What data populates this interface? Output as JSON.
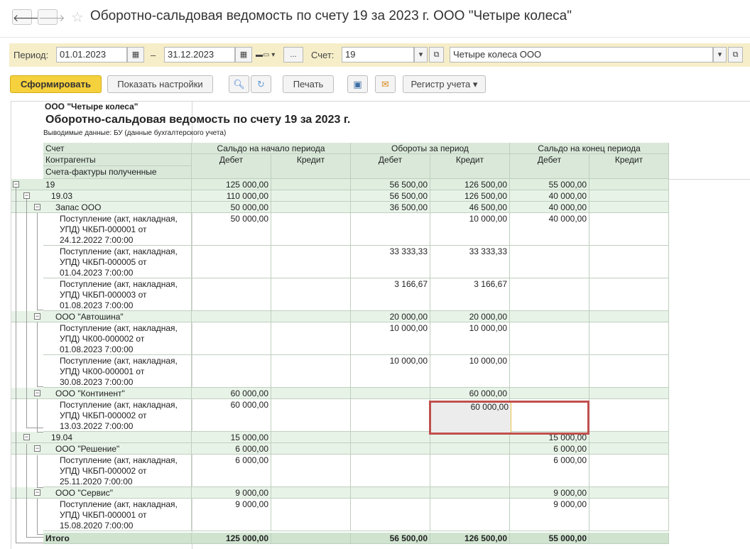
{
  "window": {
    "title": "Оборотно-сальдовая ведомость по счету 19 за 2023 г. ООО \"Четыре колеса\"",
    "back_glyph": "🡐",
    "fwd_glyph": "🡒",
    "star_glyph": "☆"
  },
  "params": {
    "period_label": "Период:",
    "date_from": "01.01.2023",
    "dash": "–",
    "date_to": "31.12.2023",
    "ellipsis": "...",
    "account_label": "Счет:",
    "account": "19",
    "org": "Четыре колеса ООО"
  },
  "toolbar": {
    "generate": "Сформировать",
    "show_settings": "Показать настройки",
    "print": "Печать",
    "register": "Регистр учета"
  },
  "report": {
    "org": "ООО \"Четыре колеса\"",
    "title": "Оборотно-сальдовая ведомость по счету 19 за 2023 г.",
    "subtitle": "Выводимые данные: БУ (данные бухгалтерского учета)",
    "headers": {
      "col1_line1": "Счет",
      "col1_line2": "Контрагенты",
      "col1_line3": "Счета-фактуры полученные",
      "opening": "Сальдо на начало периода",
      "turnover": "Обороты за период",
      "closing": "Сальдо на конец периода",
      "debit": "Дебет",
      "credit": "Кредит"
    },
    "rows": [
      {
        "text": "19",
        "lvl": 0,
        "kind": "g0",
        "v": [
          "125 000,00",
          "",
          "56 500,00",
          "126 500,00",
          "55 000,00",
          ""
        ]
      },
      {
        "text": "19.03",
        "lvl": 1,
        "kind": "g1",
        "v": [
          "110 000,00",
          "",
          "56 500,00",
          "126 500,00",
          "40 000,00",
          ""
        ]
      },
      {
        "text": "Запас ООО",
        "lvl": 2,
        "kind": "g1",
        "v": [
          "50 000,00",
          "",
          "36 500,00",
          "46 500,00",
          "40 000,00",
          ""
        ]
      },
      {
        "text": "Поступление (акт, накладная, УПД) ЧКБП-000001 от 24.12.2022 7:00:00",
        "lvl": 3,
        "kind": "doc",
        "v": [
          "50 000,00",
          "",
          "",
          "10 000,00",
          "40 000,00",
          ""
        ]
      },
      {
        "text": "Поступление (акт, накладная, УПД) ЧКБП-000005 от 01.04.2023 7:00:00",
        "lvl": 3,
        "kind": "doc",
        "v": [
          "",
          "",
          "33 333,33",
          "33 333,33",
          "",
          ""
        ]
      },
      {
        "text": "Поступление (акт, накладная, УПД) ЧКБП-000003 от 01.08.2023 7:00:00",
        "lvl": 3,
        "kind": "doc",
        "v": [
          "",
          "",
          "3 166,67",
          "3 166,67",
          "",
          ""
        ]
      },
      {
        "text": "ООО \"Автошина\"",
        "lvl": 2,
        "kind": "g1",
        "v": [
          "",
          "",
          "20 000,00",
          "20 000,00",
          "",
          ""
        ]
      },
      {
        "text": "Поступление (акт, накладная, УПД) ЧК00-000002 от 01.08.2023 7:00:00",
        "lvl": 3,
        "kind": "doc",
        "v": [
          "",
          "",
          "10 000,00",
          "10 000,00",
          "",
          ""
        ]
      },
      {
        "text": "Поступление (акт, накладная, УПД) ЧК00-000001 от 30.08.2023 7:00:00",
        "lvl": 3,
        "kind": "doc",
        "v": [
          "",
          "",
          "10 000,00",
          "10 000,00",
          "",
          ""
        ]
      },
      {
        "text": "ООО \"Континент\"",
        "lvl": 2,
        "kind": "g1",
        "v": [
          "60 000,00",
          "",
          "",
          "60 000,00",
          "",
          ""
        ]
      },
      {
        "text": "Поступление (акт, накладная, УПД) ЧКБП-000002 от 13.03.2022 7:00:00",
        "lvl": 3,
        "kind": "doc",
        "v": [
          "60 000,00",
          "",
          "",
          "60 000,00",
          "",
          ""
        ]
      },
      {
        "text": "19.04",
        "lvl": 1,
        "kind": "g1",
        "v": [
          "15 000,00",
          "",
          "",
          "",
          "15 000,00",
          ""
        ]
      },
      {
        "text": "ООО \"Решение\"",
        "lvl": 2,
        "kind": "g1",
        "v": [
          "6 000,00",
          "",
          "",
          "",
          "6 000,00",
          ""
        ]
      },
      {
        "text": "Поступление (акт, накладная, УПД) ЧКБП-000002 от 25.11.2020 7:00:00",
        "lvl": 3,
        "kind": "doc",
        "v": [
          "6 000,00",
          "",
          "",
          "",
          "6 000,00",
          ""
        ]
      },
      {
        "text": "ООО \"Сервис\"",
        "lvl": 2,
        "kind": "g1",
        "v": [
          "9 000,00",
          "",
          "",
          "",
          "9 000,00",
          ""
        ]
      },
      {
        "text": "Поступление (акт, накладная, УПД) ЧКБП-000001 от 15.08.2020 7:00:00",
        "lvl": 3,
        "kind": "doc",
        "v": [
          "9 000,00",
          "",
          "",
          "",
          "9 000,00",
          ""
        ]
      }
    ],
    "total": {
      "text": "Итого",
      "v": [
        "125 000,00",
        "",
        "56 500,00",
        "126 500,00",
        "55 000,00",
        ""
      ]
    }
  }
}
